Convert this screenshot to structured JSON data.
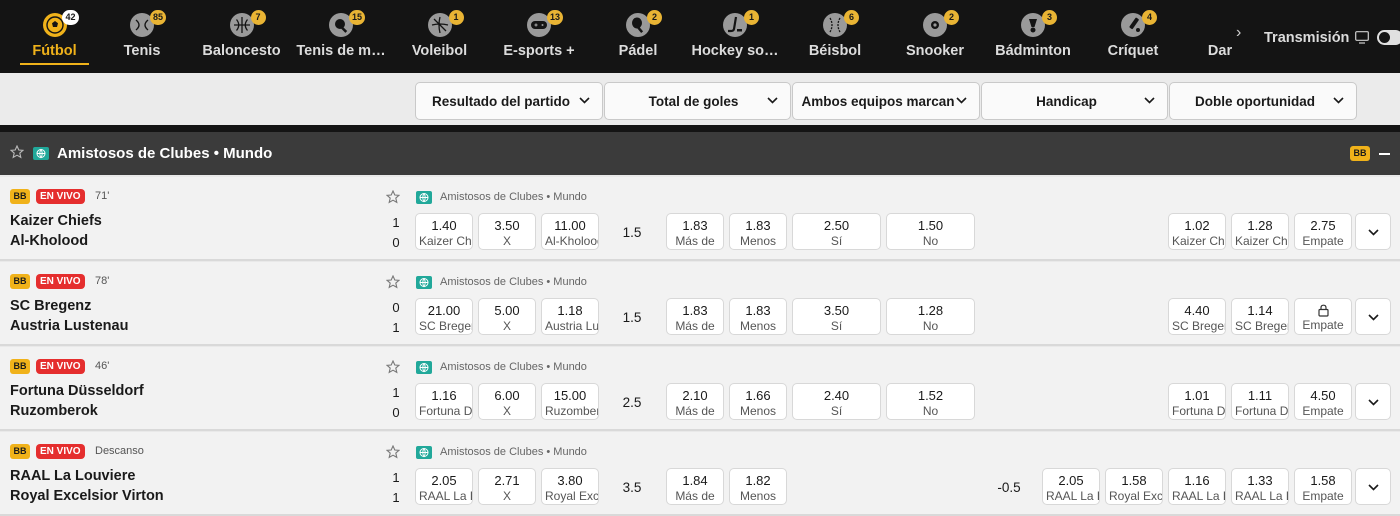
{
  "sports_nav": {
    "items": [
      {
        "label": "Fútbol",
        "count": "42",
        "icon": "soccer-ball-icon",
        "active": true
      },
      {
        "label": "Tenis",
        "count": "85",
        "icon": "tennis-ball-icon"
      },
      {
        "label": "Baloncesto",
        "count": "7",
        "icon": "basketball-icon"
      },
      {
        "label": "Tenis de m…",
        "count": "15",
        "icon": "table-tennis-icon"
      },
      {
        "label": "Voleibol",
        "count": "1",
        "icon": "volleyball-icon"
      },
      {
        "label": "E-sports +",
        "count": "13",
        "icon": "gamepad-icon"
      },
      {
        "label": "Pádel",
        "count": "2",
        "icon": "padel-racket-icon"
      },
      {
        "label": "Hockey so…",
        "count": "1",
        "icon": "hockey-stick-icon"
      },
      {
        "label": "Béisbol",
        "count": "6",
        "icon": "baseball-icon"
      },
      {
        "label": "Snooker",
        "count": "2",
        "icon": "snooker-ball-icon"
      },
      {
        "label": "Bádminton",
        "count": "3",
        "icon": "shuttlecock-icon"
      },
      {
        "label": "Críquet",
        "count": "4",
        "icon": "cricket-bat-icon"
      },
      {
        "label": "Dar",
        "count": "",
        "icon": "darts-icon"
      }
    ],
    "streaming_label": "Transmisión"
  },
  "market_filters": [
    {
      "label": "Resultado del partido"
    },
    {
      "label": "Total de goles"
    },
    {
      "label": "Ambos equipos marcan"
    },
    {
      "label": "Handicap"
    },
    {
      "label": "Doble oportunidad"
    }
  ],
  "league_header": {
    "name": "Amistosos de Clubes • Mundo",
    "bb": "BB"
  },
  "matches": [
    {
      "bb": "BB",
      "live": "EN VIVO",
      "time": "71'",
      "home": "Kaizer Chiefs",
      "away": "Al-Kholood",
      "home_score": "1",
      "away_score": "0",
      "league": "Amistosos de Clubes • Mundo",
      "result": [
        {
          "v": "1.40",
          "l": "Kaizer Chiefs"
        },
        {
          "v": "3.50",
          "l": "X"
        },
        {
          "v": "11.00",
          "l": "Al-Kholood"
        }
      ],
      "total_line": "1.5",
      "total": [
        {
          "v": "1.83",
          "l": "Más de"
        },
        {
          "v": "1.83",
          "l": "Menos"
        }
      ],
      "btts": [
        {
          "v": "2.50",
          "l": "Sí"
        },
        {
          "v": "1.50",
          "l": "No"
        }
      ],
      "handicap_line": "",
      "handicap": [],
      "double": [
        {
          "v": "1.02",
          "l": "Kaizer Chiefs"
        },
        {
          "v": "1.28",
          "l": "Kaizer Chiefs"
        },
        {
          "v": "2.75",
          "l": "Empate"
        }
      ]
    },
    {
      "bb": "BB",
      "live": "EN VIVO",
      "time": "78'",
      "home": "SC Bregenz",
      "away": "Austria Lustenau",
      "home_score": "0",
      "away_score": "1",
      "league": "Amistosos de Clubes • Mundo",
      "result": [
        {
          "v": "21.00",
          "l": "SC Bregenz"
        },
        {
          "v": "5.00",
          "l": "X"
        },
        {
          "v": "1.18",
          "l": "Austria Lustenau"
        }
      ],
      "total_line": "1.5",
      "total": [
        {
          "v": "1.83",
          "l": "Más de"
        },
        {
          "v": "1.83",
          "l": "Menos"
        }
      ],
      "btts": [
        {
          "v": "3.50",
          "l": "Sí"
        },
        {
          "v": "1.28",
          "l": "No"
        }
      ],
      "handicap_line": "",
      "handicap": [],
      "double": [
        {
          "v": "4.40",
          "l": "SC Bregenz"
        },
        {
          "v": "1.14",
          "l": "SC Bregenz"
        },
        {
          "v": "",
          "l": "Empate",
          "locked": true
        }
      ]
    },
    {
      "bb": "BB",
      "live": "EN VIVO",
      "time": "46'",
      "home": "Fortuna Düsseldorf",
      "away": "Ruzomberok",
      "home_score": "1",
      "away_score": "0",
      "league": "Amistosos de Clubes • Mundo",
      "result": [
        {
          "v": "1.16",
          "l": "Fortuna Düsseldorf"
        },
        {
          "v": "6.00",
          "l": "X"
        },
        {
          "v": "15.00",
          "l": "Ruzomberok"
        }
      ],
      "total_line": "2.5",
      "total": [
        {
          "v": "2.10",
          "l": "Más de"
        },
        {
          "v": "1.66",
          "l": "Menos"
        }
      ],
      "btts": [
        {
          "v": "2.40",
          "l": "Sí"
        },
        {
          "v": "1.52",
          "l": "No"
        }
      ],
      "handicap_line": "",
      "handicap": [],
      "double": [
        {
          "v": "1.01",
          "l": "Fortuna Düsseldorf"
        },
        {
          "v": "1.11",
          "l": "Fortuna Düsseldorf"
        },
        {
          "v": "4.50",
          "l": "Empate"
        }
      ]
    },
    {
      "bb": "BB",
      "live": "EN VIVO",
      "time": "Descanso",
      "home": "RAAL La Louviere",
      "away": "Royal Excelsior Virton",
      "home_score": "1",
      "away_score": "1",
      "league": "Amistosos de Clubes • Mundo",
      "result": [
        {
          "v": "2.05",
          "l": "RAAL La Louviere"
        },
        {
          "v": "2.71",
          "l": "X"
        },
        {
          "v": "3.80",
          "l": "Royal Excelsior Virton"
        }
      ],
      "total_line": "3.5",
      "total": [
        {
          "v": "1.84",
          "l": "Más de"
        },
        {
          "v": "1.82",
          "l": "Menos"
        }
      ],
      "btts": [],
      "handicap_line": "-0.5",
      "handicap": [
        {
          "v": "2.05",
          "l": "RAAL La Louviere"
        },
        {
          "v": "1.58",
          "l": "Royal Excelsior Virton"
        }
      ],
      "double": [
        {
          "v": "1.16",
          "l": "RAAL La Louviere"
        },
        {
          "v": "1.33",
          "l": "RAAL La Louviere"
        },
        {
          "v": "1.58",
          "l": "Empate"
        }
      ]
    }
  ],
  "colors": {
    "accent": "#f0b21a",
    "nav_bg": "#141414",
    "league_bg": "#3b3b3b",
    "live_red": "#e52e2e",
    "globe_teal": "#21a89a"
  }
}
